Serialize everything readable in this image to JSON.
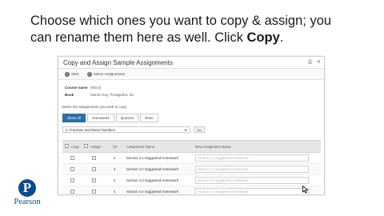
{
  "caption": {
    "line1": "Choose which ones you want to copy & assign; you",
    "line2_prefix": "can rename them here as well. Click ",
    "line2_bold": "Copy",
    "line2_suffix": "."
  },
  "dialog": {
    "title": "Copy and Assign Sample Assignments",
    "steps": [
      {
        "number": "1",
        "label": "Start"
      },
      {
        "number": "2",
        "label": "Select Assignments"
      }
    ],
    "course_name_label": "Course name",
    "course_name_value": "[WDU]",
    "book_label": "Book",
    "book_value": "Martin-Gay, Prealgebra, 8e",
    "select_instruction": "Select the assignments you wish to copy",
    "filter_tabs": [
      "Show All",
      "Homework",
      "Quizzes",
      "Tests"
    ],
    "chapter_selected": "4. Fractions and Mixed Numbers",
    "go_label": "Go",
    "columns": {
      "copy": "Copy",
      "assign": "Assign",
      "ch": "Ch",
      "name": "Assignment Name",
      "new_name": "New Assignment Name"
    },
    "rows": [
      {
        "ch": "4",
        "name": "Section 4.1 Suggested Homework",
        "new_name": "Section 4.1 Suggested Homework"
      },
      {
        "ch": "4",
        "name": "Section 4.2 Suggested Homework",
        "new_name": "Section 4.2 Suggested Homework"
      },
      {
        "ch": "4",
        "name": "Section 4.3 Suggested Homework",
        "new_name": "Section 4.3 Suggested Homework"
      },
      {
        "ch": "4",
        "name": "Section 4.4 Suggested Homework",
        "new_name": "Section 4.4 Suggested Homework"
      }
    ],
    "icons": [
      "print-icon",
      "close-icon",
      "caret-down-icon",
      "cursor-icon"
    ]
  },
  "brand": {
    "logo_letter": "P",
    "name": "Pearson",
    "color": "#0a4b8c",
    "accent": "#2a6fa8"
  }
}
